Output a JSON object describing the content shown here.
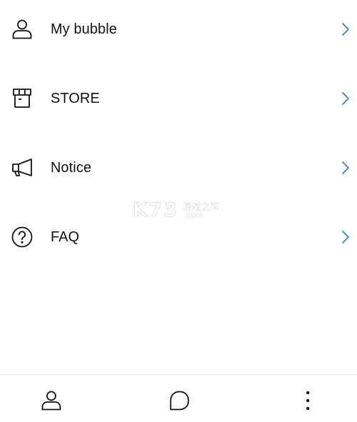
{
  "menu": {
    "items": [
      {
        "label": "My bubble",
        "icon": "person-icon"
      },
      {
        "label": "STORE",
        "icon": "store-icon"
      },
      {
        "label": "Notice",
        "icon": "megaphone-icon"
      },
      {
        "label": "FAQ",
        "icon": "question-circle-icon"
      }
    ],
    "chevron_color": "#2f7fd8"
  },
  "watermark": {
    "brand": "K73",
    "tagline": "游戏之家",
    "domain": ".com"
  },
  "bottom_nav": {
    "tabs": [
      {
        "icon": "person-icon"
      },
      {
        "icon": "chat-bubble-icon"
      },
      {
        "icon": "more-vertical-icon"
      }
    ]
  }
}
